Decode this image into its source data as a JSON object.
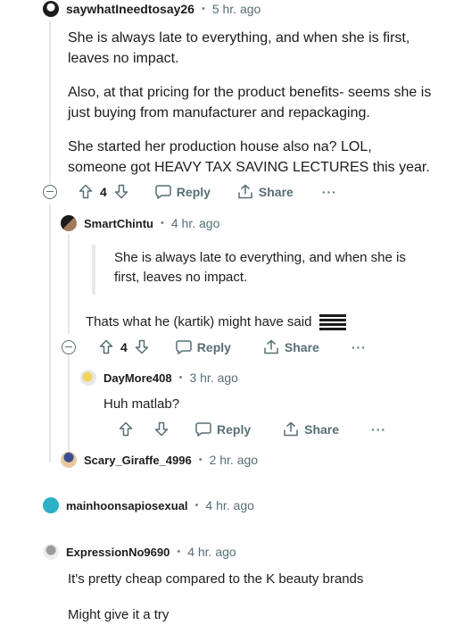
{
  "colors": {
    "meta": "#576f76",
    "text": "#1c1c1c",
    "thread": "#e6e6e6"
  },
  "c1": {
    "user": "saywhatIneedtosay26",
    "time": "5 hr. ago",
    "p1": "She is always late to everything, and when she is first, leaves no impact.",
    "p2": "Also, at that pricing for the product benefits- seems she is just buying from manufacturer and repackaging.",
    "p3": "She started her production house also na? LOL, someone got HEAVY TAX SAVING LECTURES this year.",
    "votes": "4",
    "reply": "Reply",
    "share": "Share",
    "more": "···"
  },
  "c2": {
    "user": "SmartChintu",
    "time": "4 hr. ago",
    "quote": "She is always late to everything, and when she is first, leaves no impact.",
    "text": "Thats what he (kartik) might have said",
    "votes": "4",
    "reply": "Reply",
    "share": "Share",
    "more": "···"
  },
  "c3": {
    "user": "DayMore408",
    "time": "3 hr. ago",
    "text": "Huh matlab?",
    "reply": "Reply",
    "share": "Share",
    "more": "···"
  },
  "c4": {
    "user": "Scary_Giraffe_4996",
    "time": "2 hr. ago"
  },
  "c5": {
    "user": "mainhoonsapiosexual",
    "time": "4 hr. ago"
  },
  "c6": {
    "user": "ExpressionNo9690",
    "time": "4 hr. ago",
    "p1": "It's pretty cheap compared to the K beauty brands",
    "p2": "Might give it a try"
  },
  "dot": "•"
}
